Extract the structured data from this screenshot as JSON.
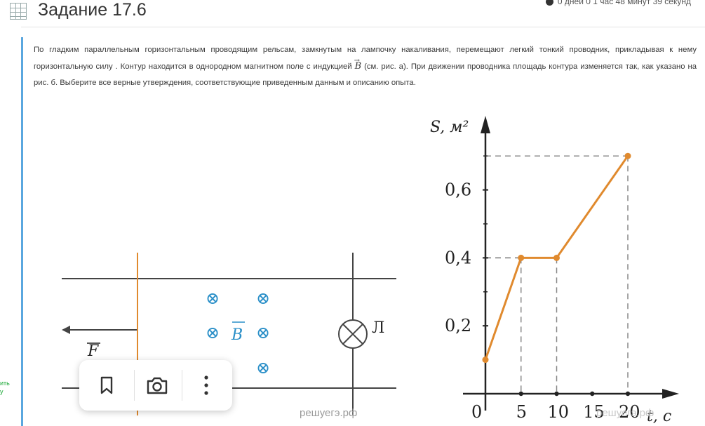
{
  "header": {
    "title": "Задание 17.6",
    "timer": "0 дней 0 1 час 48 минут 39 секунд"
  },
  "side": {
    "accent_text_1": "ить",
    "accent_text_2": "у"
  },
  "task": {
    "text_part1": "По гладким параллельным горизонтальным проводящим рельсам, замкнутым на лампочку накаливания, перемещают легкий тонкий проводник, прикладывая к нему горизонтальную силу . Контур находится в однородном магнитном поле с индукцией ",
    "vector_symbol": "B",
    "text_part2": " (см. рис. а). При движении проводника площадь контура изменяется так, как указано на рис. б. Выберите все верные утверждения, соответствующие приведенным данным и описанию опыта."
  },
  "figure_a": {
    "force_label": "F",
    "field_label": "B",
    "lamp_label": "Л",
    "field_symbol": "⊗",
    "watermark": "решуегэ.рф"
  },
  "chart_data": {
    "type": "line",
    "xlabel": "t, c",
    "ylabel": "S, м²",
    "x": [
      0,
      5,
      10,
      20
    ],
    "y": [
      0.1,
      0.4,
      0.4,
      0.7
    ],
    "xticks": [
      "0",
      "5",
      "10",
      "15",
      "20"
    ],
    "yticks": [
      "0,2",
      "0,4",
      "0,6"
    ],
    "xlim": [
      0,
      25
    ],
    "ylim": [
      0,
      0.8
    ],
    "line_color": "#e08a2e",
    "watermark": "решуегэ.рф"
  },
  "toolbar": {
    "items": [
      {
        "name": "bookmark-icon"
      },
      {
        "name": "camera-icon"
      },
      {
        "name": "more-vertical-icon"
      }
    ]
  }
}
